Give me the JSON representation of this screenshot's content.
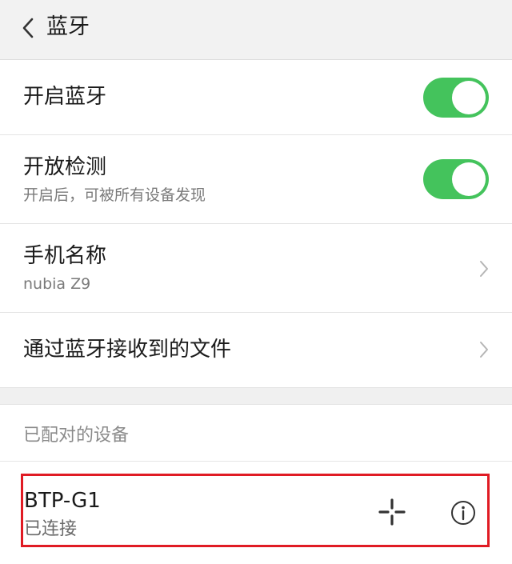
{
  "header": {
    "title": "蓝牙",
    "back_icon": "chevron-left-icon"
  },
  "settings": {
    "bluetooth_on": {
      "label": "开启蓝牙",
      "enabled": true
    },
    "discoverable": {
      "label": "开放检测",
      "subtitle": "开启后，可被所有设备发现",
      "enabled": true
    },
    "device_name": {
      "label": "手机名称",
      "value": "nubia Z9"
    },
    "received_files": {
      "label": "通过蓝牙接收到的文件"
    }
  },
  "paired_devices": {
    "section_label": "已配对的设备",
    "items": [
      {
        "name": "BTP-G1",
        "status": "已连接",
        "action_icon": "crosshair-icon",
        "info_icon": "info-icon"
      }
    ]
  },
  "colors": {
    "toggle_on": "#44c35c",
    "highlight": "#e01b24",
    "header_bg": "#f2f2f2"
  }
}
